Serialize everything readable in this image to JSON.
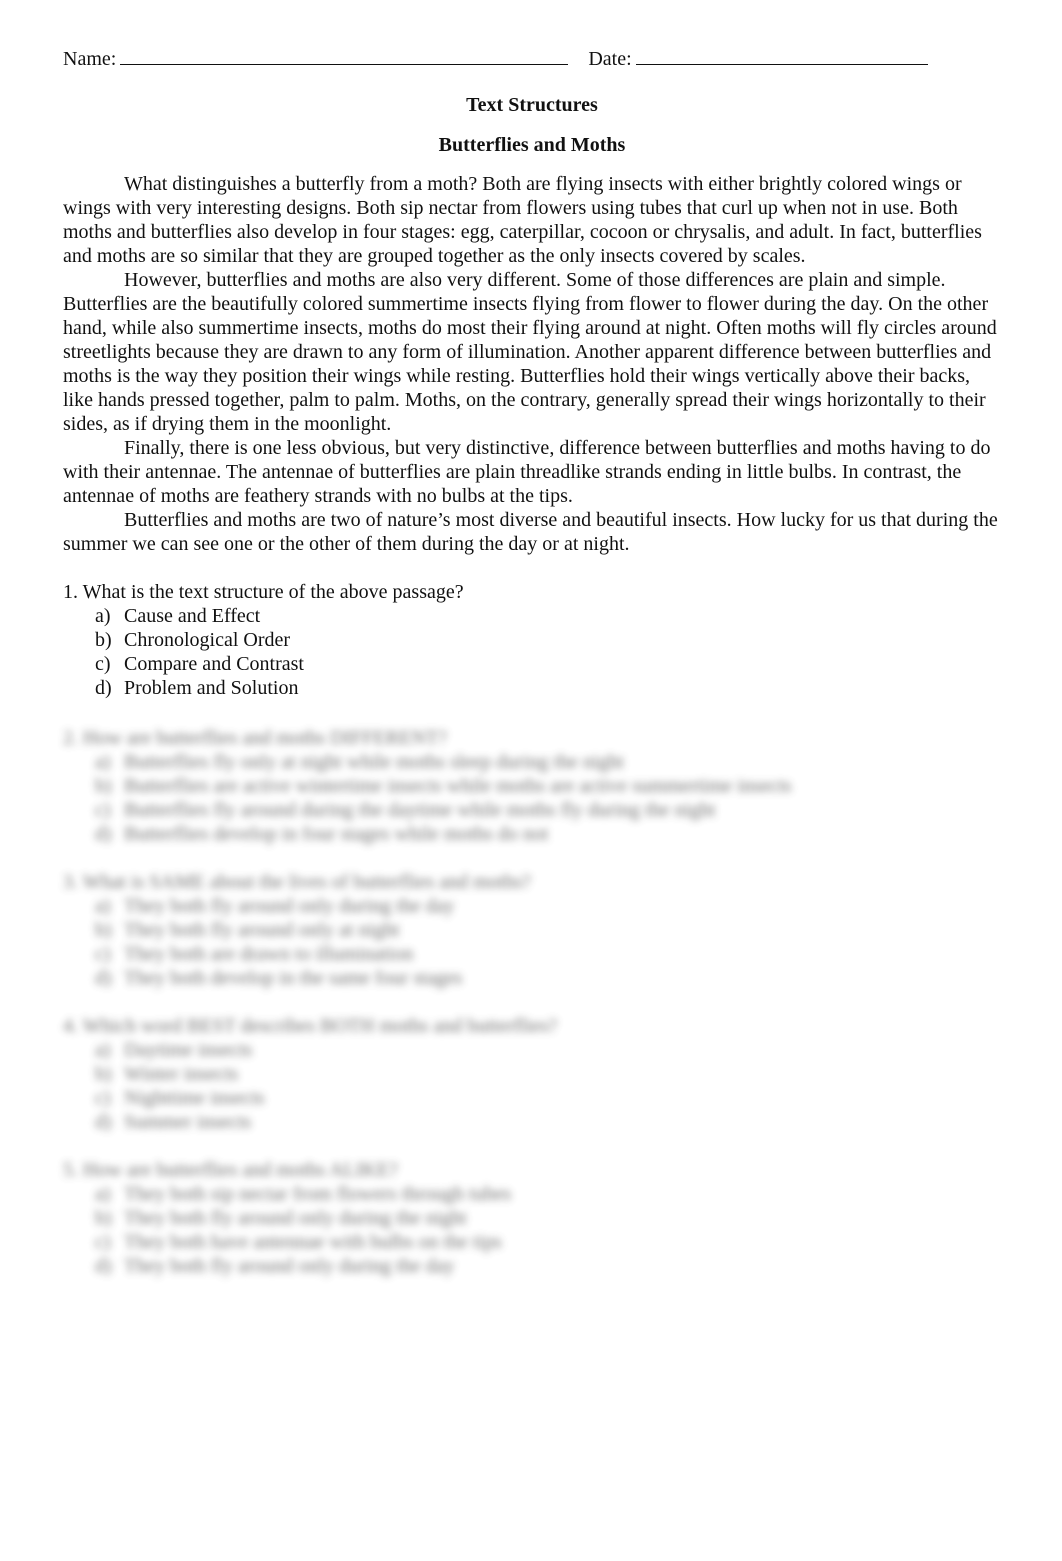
{
  "header": {
    "name_label": "Name:",
    "date_label": "Date:"
  },
  "titles": {
    "main": "Text Structures",
    "sub": "Butterflies and Moths"
  },
  "passage": {
    "paragraphs": [
      "What distinguishes a butterfly from a moth? Both are flying insects with either brightly colored wings or wings with very interesting designs.  Both sip nectar from flowers using tubes that curl up when not in use. Both moths and butterflies also develop in four stages: egg, caterpillar, cocoon or chrysalis, and adult.  In fact, butterflies and moths are so similar that they are grouped together as the only insects covered by scales.",
      "However, butterflies and moths are also very different. Some of those differences are plain and simple. Butterflies are the beautifully colored summertime insects flying from flower to flower during the day.  On the other hand, while also summertime insects, moths do most their flying around at night.  Often moths will fly circles around streetlights because they are drawn to any form of illumination.  Another apparent difference between butterflies and moths is the way they position their wings while resting. Butterflies hold their wings vertically above their backs, like hands pressed together, palm to palm.  Moths, on the contrary, generally spread their wings horizontally to their sides, as if drying them in the moonlight.",
      "Finally, there is one less obvious, but very distinctive, difference between butterflies and moths having to do with their antennae.  The antennae of butterflies are plain threadlike strands ending in little bulbs.  In contrast, the antennae of moths are feathery strands with no bulbs at the tips.",
      "Butterflies and moths are two of nature’s most diverse and beautiful insects.  How lucky for us that during the summer we can see one or the other of them during the day or at night."
    ]
  },
  "questions": [
    {
      "stem": "1. What is the text structure of the above passage?",
      "blurred": false,
      "options": [
        {
          "letter": "a)",
          "text": "Cause and Effect"
        },
        {
          "letter": "b)",
          "text": "Chronological Order"
        },
        {
          "letter": "c)",
          "text": "Compare and Contrast"
        },
        {
          "letter": "d)",
          "text": "Problem and Solution"
        }
      ]
    },
    {
      "stem": "2. How are butterflies and moths DIFFERENT?",
      "blurred": true,
      "options": [
        {
          "letter": "a)",
          "text": "Butterflies fly only at night while moths sleep during the night"
        },
        {
          "letter": "b)",
          "text": "Butterflies are active wintertime insects while moths are active summertime insects"
        },
        {
          "letter": "c)",
          "text": "Butterflies fly around during the daytime while moths fly during the night"
        },
        {
          "letter": "d)",
          "text": "Butterflies develop in four stages while moths do not"
        }
      ]
    },
    {
      "stem": "3. What is SAME about the lives of butterflies and moths?",
      "blurred": true,
      "options": [
        {
          "letter": "a)",
          "text": "They both fly around only during the day"
        },
        {
          "letter": "b)",
          "text": "They both fly around only at night"
        },
        {
          "letter": "c)",
          "text": "They both are drawn to illumination"
        },
        {
          "letter": "d)",
          "text": "They both develop in the same four stages"
        }
      ]
    },
    {
      "stem": "4. Which word BEST describes BOTH moths and butterflies?",
      "blurred": true,
      "options": [
        {
          "letter": "a)",
          "text": "Daytime insects"
        },
        {
          "letter": "b)",
          "text": "Winter insects"
        },
        {
          "letter": "c)",
          "text": "Nighttime insects"
        },
        {
          "letter": "d)",
          "text": "Summer insects"
        }
      ]
    },
    {
      "stem": "5. How are butterflies and moths ALIKE?",
      "blurred": true,
      "options": [
        {
          "letter": "a)",
          "text": "They both sip nectar from flowers through tubes"
        },
        {
          "letter": "b)",
          "text": "They both fly around only during the night"
        },
        {
          "letter": "c)",
          "text": "They both have antennae with bulbs on the tips"
        },
        {
          "letter": "d)",
          "text": "They both fly around only during the day"
        }
      ]
    }
  ]
}
